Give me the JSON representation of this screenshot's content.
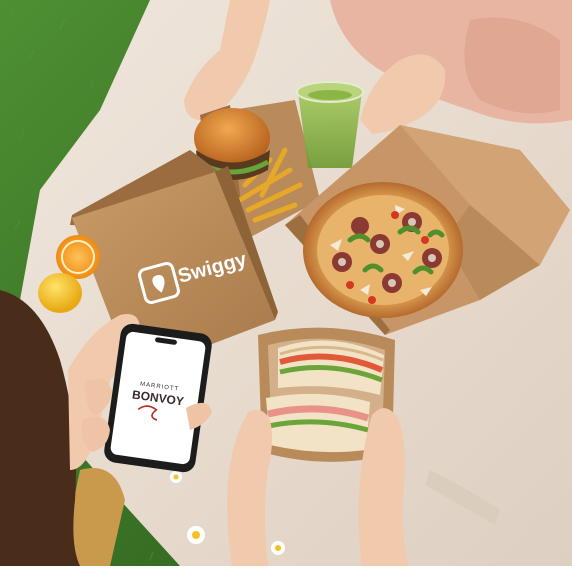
{
  "photo": {
    "swiggy_logo_text": "Swiggy",
    "phone_screen": {
      "brand_line1": "MARRIOTT",
      "brand_line2": "BONVOY"
    }
  },
  "colors": {
    "grass": "#3f7a2a",
    "blanket": "#e8ddd2",
    "kraft": "#b98a5a",
    "kraft_dark": "#8e6338",
    "pizza_crust": "#c87a3a",
    "bun": "#d9862f",
    "matcha": "#8cb548",
    "phone_body": "#1c1c1c"
  }
}
